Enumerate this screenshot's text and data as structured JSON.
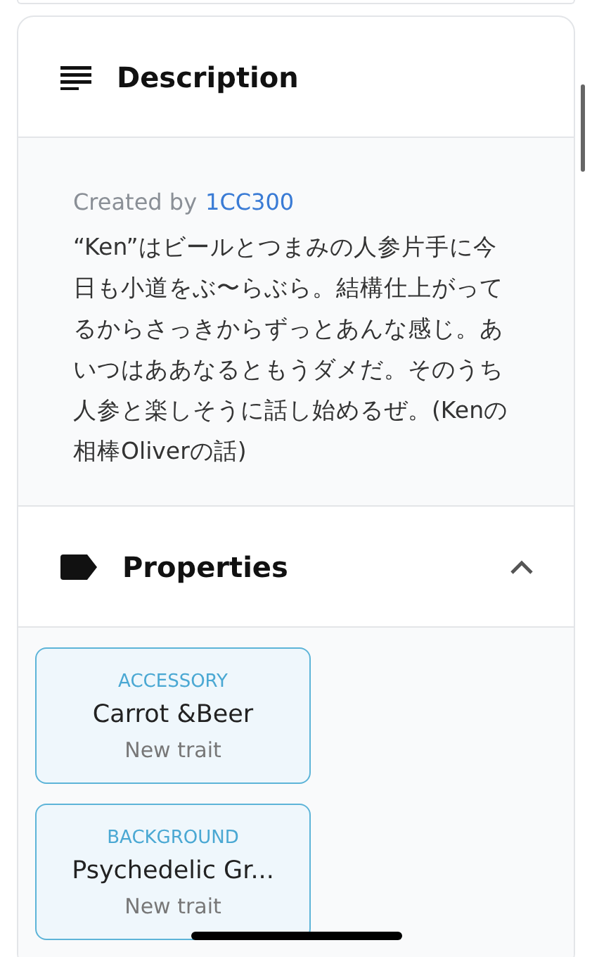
{
  "description": {
    "title": "Description",
    "created_by_label": "Created by",
    "creator": "1CC300",
    "text": "“Ken”はビールとつまみの人参片手に今日も小道をぶ〜らぶら。結構仕上がってるからさっきからずっとあんな感じ。あいつはああなるともうダメだ。そのうち人参と楽しそうに話し始めるぜ。(Kenの相棒Oliverの話)"
  },
  "properties": {
    "title": "Properties",
    "expanded": true,
    "traits": [
      {
        "type": "ACCESSORY",
        "value": "Carrot &Beer",
        "note": "New trait"
      },
      {
        "type": "BACKGROUND",
        "value": "Psychedelic Gr...",
        "note": "New trait"
      }
    ]
  }
}
